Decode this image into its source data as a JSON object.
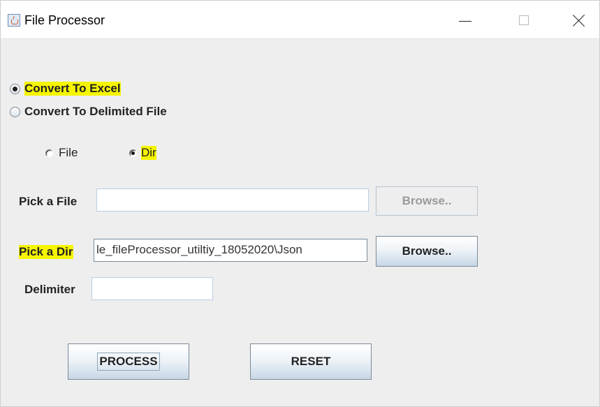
{
  "window": {
    "title": "File Processor",
    "icon": "java-cup-icon"
  },
  "conversion": {
    "options": [
      {
        "label": "Convert To Excel",
        "checked": true,
        "highlighted": true
      },
      {
        "label": "Convert To Delimited File",
        "checked": false,
        "highlighted": false
      }
    ]
  },
  "source_type": {
    "options": [
      {
        "label": "File",
        "checked": false
      },
      {
        "label": "Dir",
        "checked": true,
        "highlighted": true
      }
    ]
  },
  "pick_file": {
    "label": "Pick a File",
    "value": "",
    "browse_label": "Browse..",
    "browse_enabled": false
  },
  "pick_dir": {
    "label": "Pick a Dir",
    "value": "le_fileProcessor_utiltiy_18052020\\Json",
    "browse_label": "Browse..",
    "browse_enabled": true,
    "label_highlighted": true
  },
  "delimiter": {
    "label": "Delimiter",
    "value": ""
  },
  "actions": {
    "process_label": "PROCESS",
    "reset_label": "RESET"
  },
  "colors": {
    "highlight": "#f5f500",
    "window_bg": "#eeeeee"
  }
}
